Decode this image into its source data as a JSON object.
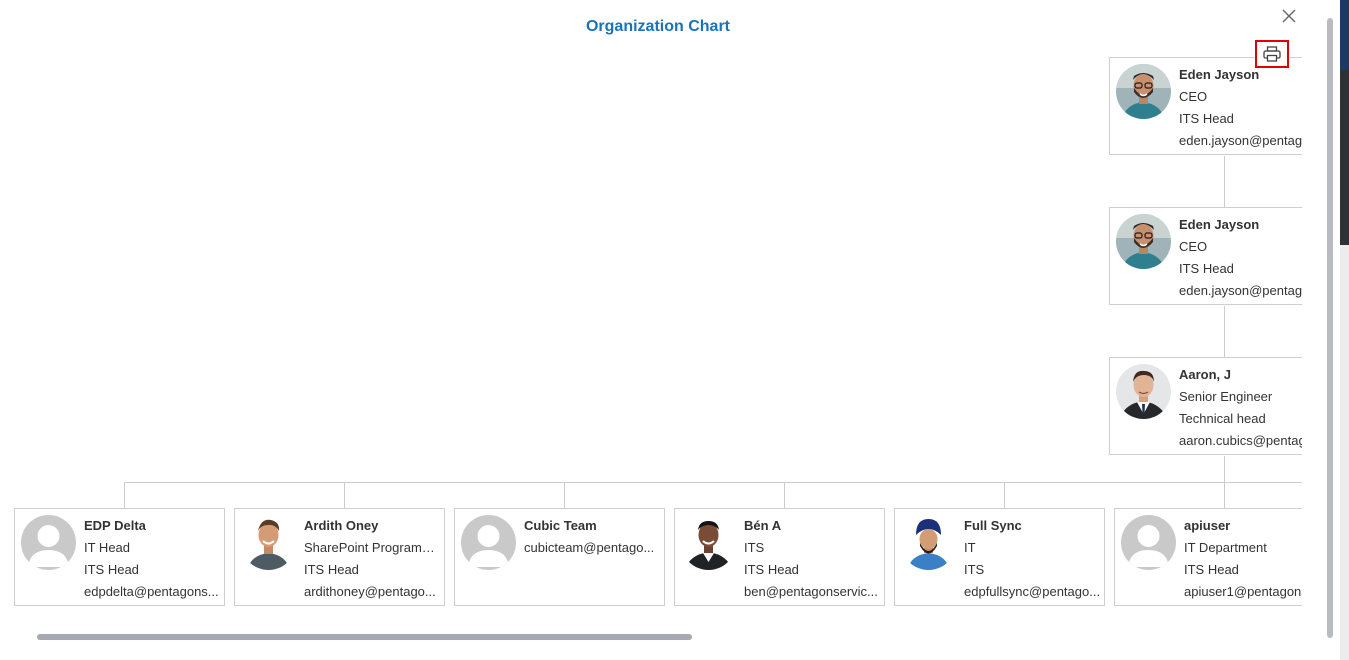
{
  "header": {
    "title": "Organization Chart"
  },
  "icons": {
    "close": "close-icon",
    "print": "printer-icon"
  },
  "colors": {
    "title": "#1a73b8",
    "print_highlight": "#e00000"
  },
  "chain": [
    {
      "name": "Eden Jayson",
      "role": "CEO",
      "dept": "ITS Head",
      "email": "eden.jayson@pentagc",
      "avatar": "photo-man-beard-glasses"
    },
    {
      "name": "Eden Jayson",
      "role": "CEO",
      "dept": "ITS Head",
      "email": "eden.jayson@pentagc",
      "avatar": "photo-man-beard-glasses"
    },
    {
      "name": "Aaron, J",
      "role": "Senior Engineer",
      "dept": "Technical head",
      "email": "aaron.cubics@pentag",
      "avatar": "photo-man-suit"
    }
  ],
  "reports": [
    {
      "name": "EDP Delta",
      "role": "IT Head",
      "dept": "ITS Head",
      "email": "edpdelta@pentagons...",
      "avatar": "placeholder"
    },
    {
      "name": "Ardith Oney",
      "role": "SharePoint Programm...",
      "dept": "ITS Head",
      "email": "ardithoney@pentago...",
      "avatar": "photo-man-smiling"
    },
    {
      "name": "Cubic Team",
      "email": "cubicteam@pentago...",
      "avatar": "placeholder"
    },
    {
      "name": "Bén A",
      "role": "ITS",
      "dept": "ITS Head",
      "email": "ben@pentagonservic...",
      "avatar": "photo-man-dark"
    },
    {
      "name": "Full Sync",
      "role": "IT",
      "dept": "ITS",
      "email": "edpfullsync@pentago...",
      "avatar": "photo-man-turban"
    },
    {
      "name": "apiuser",
      "role": "IT Department",
      "dept": "ITS Head",
      "email": "apiuser1@pentagons",
      "avatar": "placeholder"
    }
  ]
}
